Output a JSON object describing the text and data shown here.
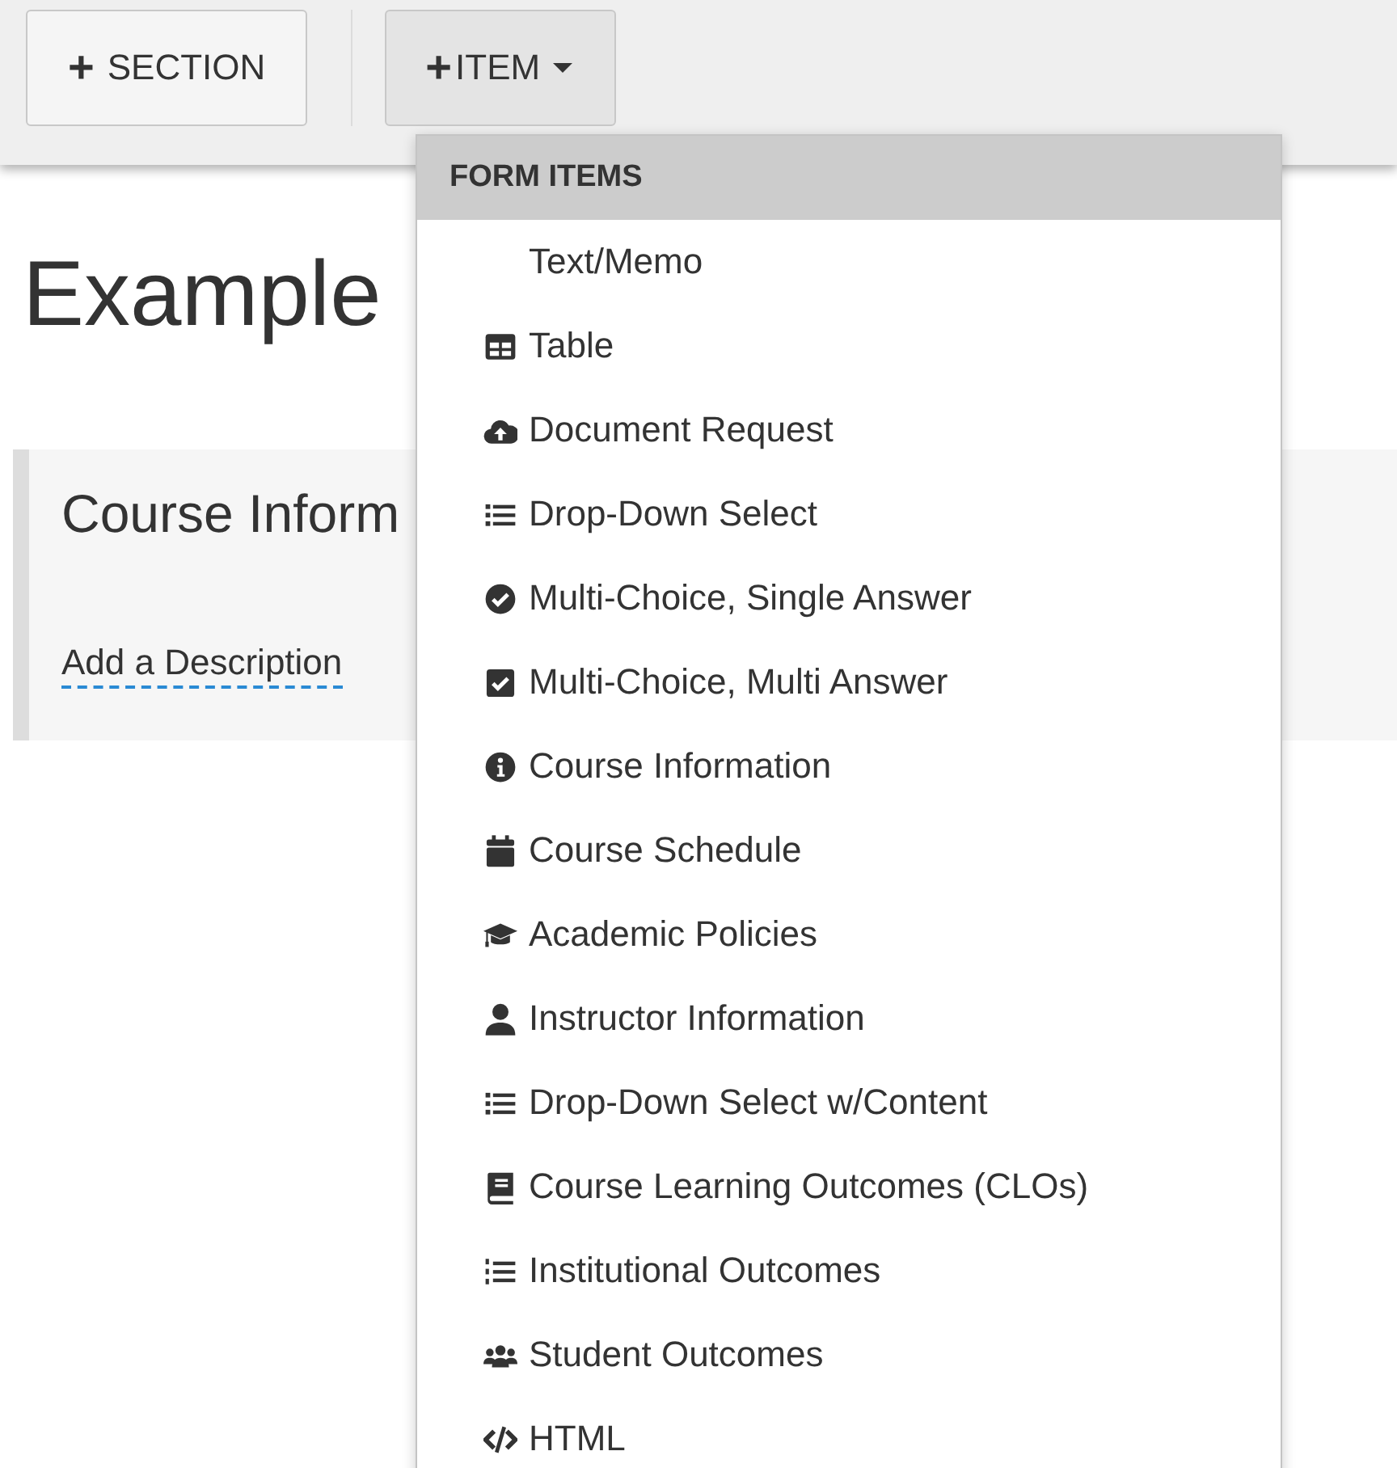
{
  "toolbar": {
    "buttons": [
      {
        "icon": "+",
        "label": "SECTION",
        "dropdown": false,
        "pressed": false
      },
      {
        "icon": "+",
        "label": "ITEM",
        "dropdown": true,
        "pressed": true
      }
    ]
  },
  "page": {
    "title": "Example",
    "section": {
      "title": "Course Inform",
      "description": "Add a Description"
    }
  },
  "menu": {
    "header": "FORM ITEMS",
    "items": [
      {
        "label": "Text/Memo",
        "kind": "none"
      },
      {
        "label": "Table",
        "kind": "table"
      },
      {
        "label": "Document Request",
        "kind": "cloud-upload"
      },
      {
        "label": "Drop-Down Select",
        "kind": "list"
      },
      {
        "label": "Multi-Choice, Single Answer",
        "kind": "check-circle"
      },
      {
        "label": "Multi-Choice, Multi Answer",
        "kind": "check-square"
      },
      {
        "label": "Course Information",
        "kind": "info"
      },
      {
        "label": "Course Schedule",
        "kind": "calendar"
      },
      {
        "label": "Academic Policies",
        "kind": "graduation-cap"
      },
      {
        "label": "Instructor Information",
        "kind": "user"
      },
      {
        "label": "Drop-Down Select w/Content",
        "kind": "list"
      },
      {
        "label": "Course Learning Outcomes (CLOs)",
        "kind": "book"
      },
      {
        "label": "Institutional Outcomes",
        "kind": "numbered-list"
      },
      {
        "label": "Student Outcomes",
        "kind": "users"
      },
      {
        "label": "HTML",
        "kind": "code"
      }
    ]
  }
}
